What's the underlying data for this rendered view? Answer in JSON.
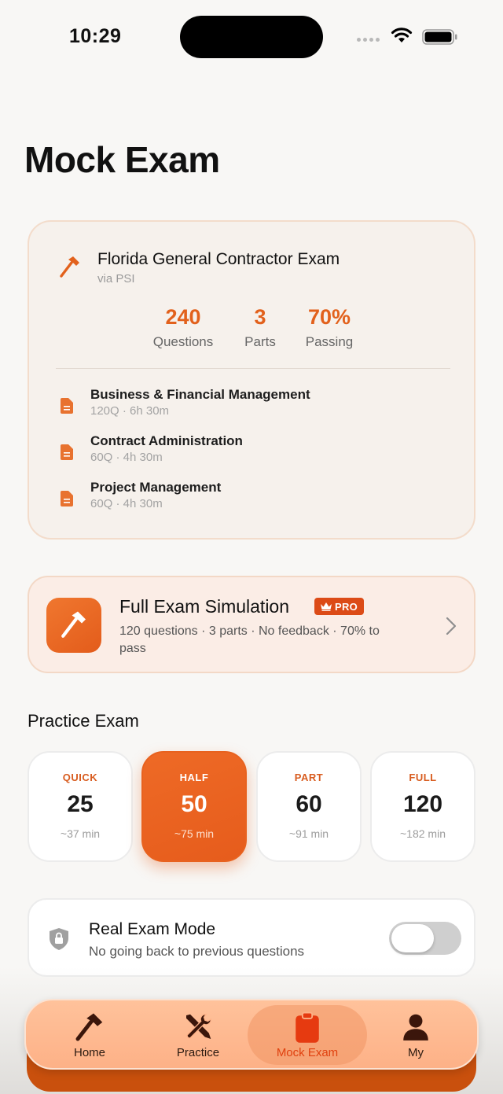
{
  "status_bar": {
    "time": "10:29"
  },
  "page_title": "Mock Exam",
  "exam": {
    "name": "Florida General Contractor Exam",
    "provider": "via PSI",
    "stats": [
      {
        "value": "240",
        "label": "Questions"
      },
      {
        "value": "3",
        "label": "Parts"
      },
      {
        "value": "70%",
        "label": "Passing"
      }
    ],
    "parts": [
      {
        "name": "Business & Financial Management",
        "meta": "120Q · 6h 30m"
      },
      {
        "name": "Contract Administration",
        "meta": "60Q · 4h 30m"
      },
      {
        "name": "Project Management",
        "meta": "60Q · 4h 30m"
      }
    ]
  },
  "simulation": {
    "title": "Full Exam Simulation",
    "badge": "PRO",
    "description": "120 questions · 3 parts · No feedback · 70% to pass"
  },
  "practice": {
    "title": "Practice Exam",
    "selected": 1,
    "options": [
      {
        "label": "QUICK",
        "count": "25",
        "time": "~37 min"
      },
      {
        "label": "HALF",
        "count": "50",
        "time": "~75 min"
      },
      {
        "label": "PART",
        "count": "60",
        "time": "~91 min"
      },
      {
        "label": "FULL",
        "count": "120",
        "time": "~182 min"
      }
    ]
  },
  "real_exam_mode": {
    "title": "Real Exam Mode",
    "description": "No going back to previous questions",
    "enabled": false
  },
  "tabs": [
    {
      "label": "Home",
      "icon": "hammer-icon"
    },
    {
      "label": "Practice",
      "icon": "tools-icon"
    },
    {
      "label": "Mock Exam",
      "icon": "clipboard-icon",
      "active": true
    },
    {
      "label": "My",
      "icon": "person-icon"
    }
  ],
  "colors": {
    "accent": "#e2611c",
    "pro_badge": "#dc4b17",
    "tab_bar": "#fdb187"
  }
}
